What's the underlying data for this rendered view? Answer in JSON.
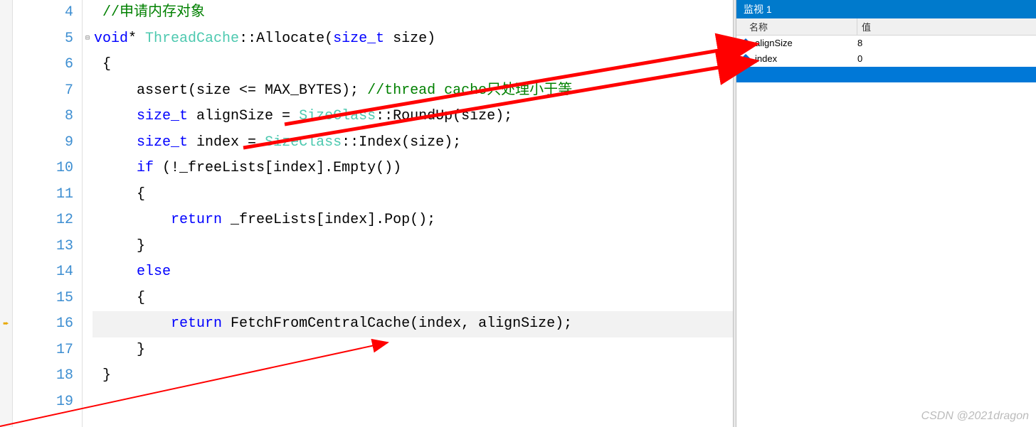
{
  "editor": {
    "lines": [
      {
        "num": 4,
        "marker": "",
        "fold": "",
        "tokens": [
          {
            "t": " ",
            "c": ""
          },
          {
            "t": "//申请内存对象",
            "c": "comment"
          }
        ]
      },
      {
        "num": 5,
        "marker": "",
        "fold": "⊟",
        "tokens": [
          {
            "t": "void",
            "c": "kw"
          },
          {
            "t": "* ",
            "c": "op"
          },
          {
            "t": "ThreadCache",
            "c": "cls"
          },
          {
            "t": "::Allocate(",
            "c": "op"
          },
          {
            "t": "size_t",
            "c": "kw"
          },
          {
            "t": " size)",
            "c": "op"
          }
        ]
      },
      {
        "num": 6,
        "marker": "",
        "fold": "",
        "tokens": [
          {
            "t": " {",
            "c": "op"
          }
        ]
      },
      {
        "num": 7,
        "marker": "",
        "fold": "",
        "tokens": [
          {
            "t": "     assert(size <= MAX_BYTES); ",
            "c": ""
          },
          {
            "t": "//thread cache只处理小于等",
            "c": "comment"
          }
        ]
      },
      {
        "num": 8,
        "marker": "",
        "fold": "",
        "tokens": [
          {
            "t": "     ",
            "c": ""
          },
          {
            "t": "size_t",
            "c": "kw"
          },
          {
            "t": " alignSize = ",
            "c": ""
          },
          {
            "t": "SizeClass",
            "c": "cls"
          },
          {
            "t": "::RoundUp(size);",
            "c": ""
          }
        ]
      },
      {
        "num": 9,
        "marker": "",
        "fold": "",
        "tokens": [
          {
            "t": "     ",
            "c": ""
          },
          {
            "t": "size_t",
            "c": "kw"
          },
          {
            "t": " index = ",
            "c": ""
          },
          {
            "t": "SizeClass",
            "c": "cls"
          },
          {
            "t": "::Index(size);",
            "c": ""
          }
        ]
      },
      {
        "num": 10,
        "marker": "",
        "fold": "",
        "tokens": [
          {
            "t": "     ",
            "c": ""
          },
          {
            "t": "if",
            "c": "kw"
          },
          {
            "t": " (!_freeLists[index].Empty())",
            "c": ""
          }
        ]
      },
      {
        "num": 11,
        "marker": "",
        "fold": "",
        "tokens": [
          {
            "t": "     {",
            "c": ""
          }
        ]
      },
      {
        "num": 12,
        "marker": "",
        "fold": "",
        "tokens": [
          {
            "t": "         ",
            "c": ""
          },
          {
            "t": "return",
            "c": "kw"
          },
          {
            "t": " _freeLists[index].Pop();",
            "c": ""
          }
        ]
      },
      {
        "num": 13,
        "marker": "",
        "fold": "",
        "tokens": [
          {
            "t": "     }",
            "c": ""
          }
        ]
      },
      {
        "num": 14,
        "marker": "",
        "fold": "",
        "tokens": [
          {
            "t": "     ",
            "c": ""
          },
          {
            "t": "else",
            "c": "kw"
          }
        ]
      },
      {
        "num": 15,
        "marker": "",
        "fold": "",
        "tokens": [
          {
            "t": "     {",
            "c": ""
          }
        ]
      },
      {
        "num": 16,
        "marker": "➨",
        "fold": "",
        "current": true,
        "tokens": [
          {
            "t": "         ",
            "c": ""
          },
          {
            "t": "return",
            "c": "kw"
          },
          {
            "t": " FetchFromCentralCache(index, alignSize);",
            "c": ""
          }
        ]
      },
      {
        "num": 17,
        "marker": "",
        "fold": "",
        "tokens": [
          {
            "t": "     }",
            "c": ""
          }
        ]
      },
      {
        "num": 18,
        "marker": "",
        "fold": "",
        "tokens": [
          {
            "t": " }",
            "c": ""
          }
        ]
      },
      {
        "num": 19,
        "marker": "",
        "fold": "",
        "tokens": [
          {
            "t": "",
            "c": ""
          }
        ]
      }
    ]
  },
  "watch": {
    "title": "监视 1",
    "headers": {
      "name": "名称",
      "value": "值"
    },
    "rows": [
      {
        "name": "alignSize",
        "value": "8"
      },
      {
        "name": "index",
        "value": "0"
      }
    ]
  },
  "watermark": "CSDN @2021dragon"
}
